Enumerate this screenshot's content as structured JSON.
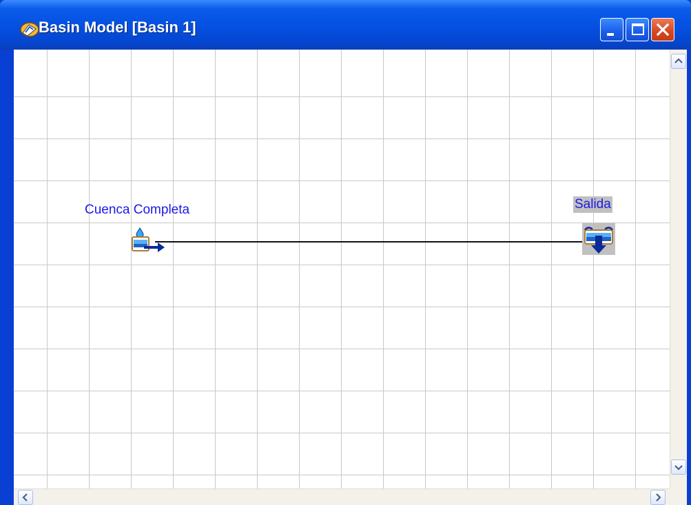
{
  "window": {
    "title": "Basin Model [Basin 1]",
    "buttons": {
      "minimize": "minimize",
      "maximize": "maximize",
      "close": "close"
    }
  },
  "icons": {
    "app": "hec-hms-app-icon",
    "subbasin": "subbasin-icon",
    "sink": "sink-icon",
    "scroll_up": "scroll-up-arrow-icon",
    "scroll_down": "scroll-down-arrow-icon",
    "scroll_left": "scroll-left-arrow-icon",
    "scroll_right": "scroll-right-arrow-icon"
  },
  "canvas": {
    "nodes": [
      {
        "id": "subbasin",
        "label": "Cuenca Completa",
        "type": "subbasin"
      },
      {
        "id": "sink",
        "label": "Salida",
        "type": "sink",
        "selected": true
      }
    ],
    "connections": [
      {
        "from": "Cuenca Completa",
        "to": "Salida"
      }
    ]
  },
  "colors": {
    "title_bar": "#0550e0",
    "node_label": "#1a1ae6",
    "grid": "#c8c8c8",
    "close_button": "#d6471f",
    "selection": "#c0c0c0"
  }
}
